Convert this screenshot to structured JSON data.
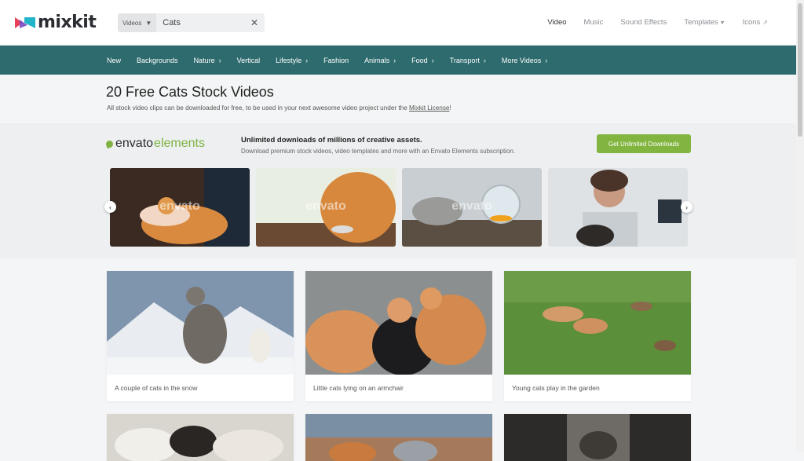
{
  "brand": {
    "name": "mixkit"
  },
  "search": {
    "type_label": "Videos",
    "query": "Cats"
  },
  "topnav": [
    {
      "label": "Video"
    },
    {
      "label": "Music"
    },
    {
      "label": "Sound Effects"
    },
    {
      "label": "Templates"
    },
    {
      "label": "Icons"
    }
  ],
  "categories": [
    {
      "label": "New",
      "has_chevron": false
    },
    {
      "label": "Backgrounds",
      "has_chevron": false
    },
    {
      "label": "Nature",
      "has_chevron": true
    },
    {
      "label": "Vertical",
      "has_chevron": false
    },
    {
      "label": "Lifestyle",
      "has_chevron": true
    },
    {
      "label": "Fashion",
      "has_chevron": false
    },
    {
      "label": "Animals",
      "has_chevron": true
    },
    {
      "label": "Food",
      "has_chevron": true
    },
    {
      "label": "Transport",
      "has_chevron": true
    },
    {
      "label": "More Videos",
      "has_chevron": true
    }
  ],
  "page": {
    "title": "20 Free Cats Stock Videos",
    "subtitle_before": "All stock video clips can be downloaded for free, to be used in your next awesome video project under the ",
    "license_link": "Mixkit License",
    "subtitle_after": "!"
  },
  "envato": {
    "logo_part1": "envato",
    "logo_part2": "elements",
    "headline": "Unlimited downloads of millions of creative assets.",
    "description": "Download premium stock videos, video templates and more with an Envato Elements subscription.",
    "cta": "Get Unlimited Downloads",
    "watermark": "envato"
  },
  "videos": [
    {
      "title": "A couple of cats in the snow"
    },
    {
      "title": "Little cats lying on an armchair"
    },
    {
      "title": "Young cats play in the garden"
    }
  ],
  "colors": {
    "brand_teal": "#2e6b6e",
    "envato_green": "#82b540"
  }
}
